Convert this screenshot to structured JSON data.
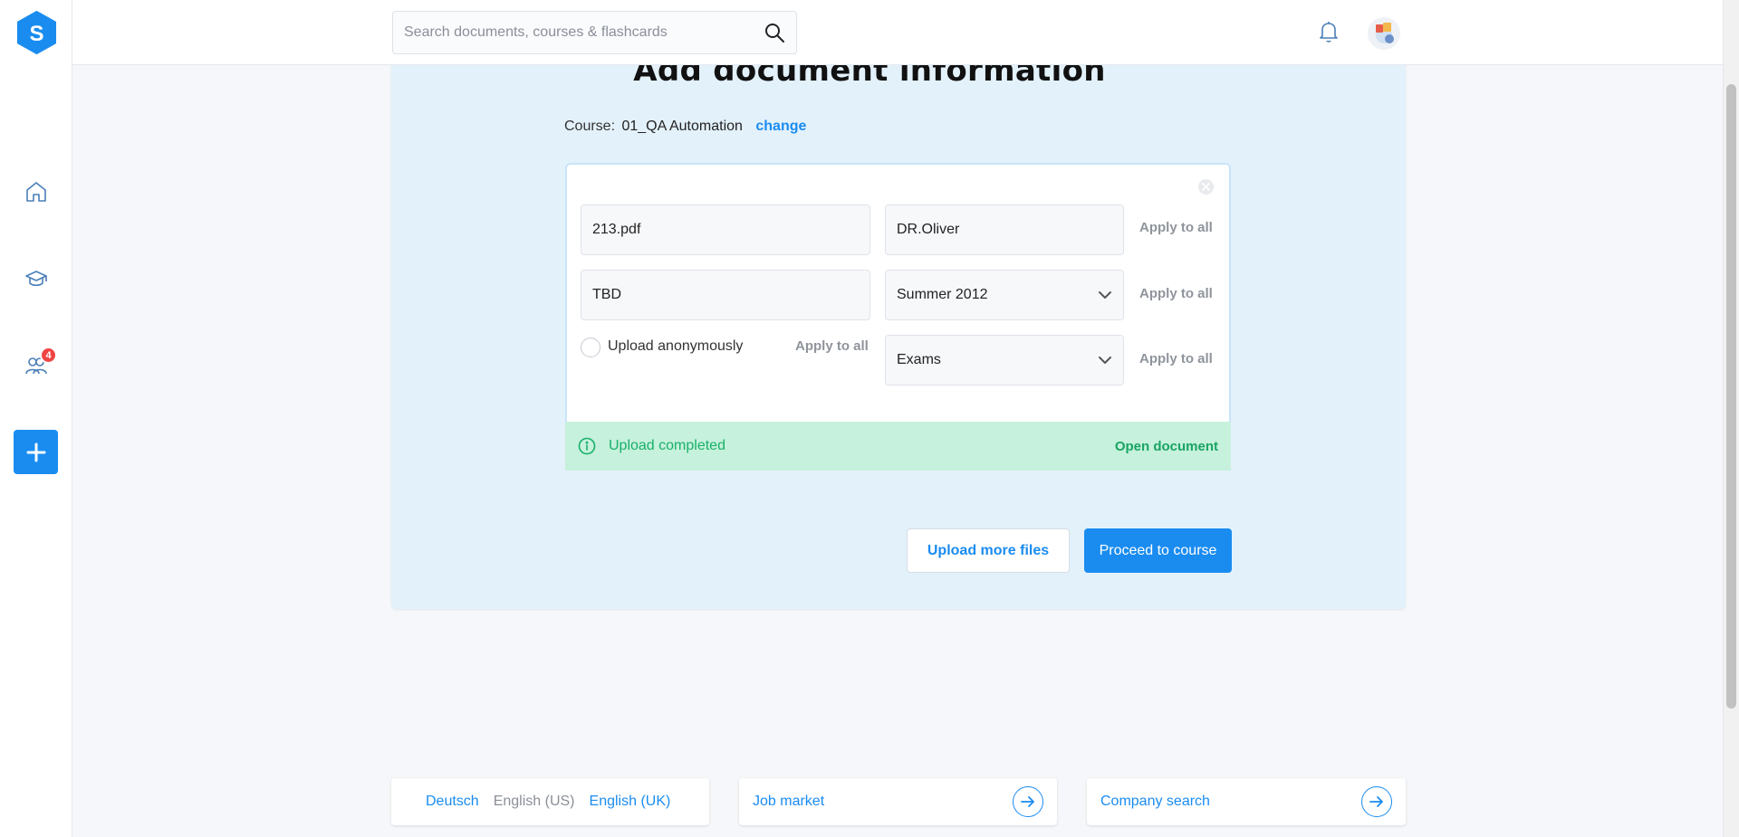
{
  "sidebar": {
    "logo_letter": "S",
    "items": [
      {
        "icon": "home-icon"
      },
      {
        "icon": "graduation-cap-icon"
      },
      {
        "icon": "people-icon",
        "badge": "4"
      }
    ],
    "add_icon": "plus-icon"
  },
  "topbar": {
    "search_placeholder": "Search documents, courses & flashcards",
    "search_value": ""
  },
  "main": {
    "title": "Add document information",
    "course_label": "Course:",
    "course_name": "01_QA Automation",
    "change_label": "change",
    "fields": {
      "file_name": "213.pdf",
      "professor": "DR.Oliver",
      "title": "TBD",
      "semester": "Summer 2012",
      "doc_type": "Exams"
    },
    "apply_to_all": "Apply to all",
    "upload_anonymously": "Upload anonymously",
    "status_text": "Upload completed",
    "open_document": "Open document",
    "upload_more": "Upload more files",
    "proceed": "Proceed to course"
  },
  "footer": {
    "languages": [
      "Deutsch",
      "English (US)",
      "English (UK)"
    ],
    "current_language": "English (US)",
    "job_market": "Job market",
    "company_search": "Company search"
  },
  "colors": {
    "accent": "#1a8cf0",
    "success": "#19b06a",
    "badge": "#ef4444"
  }
}
